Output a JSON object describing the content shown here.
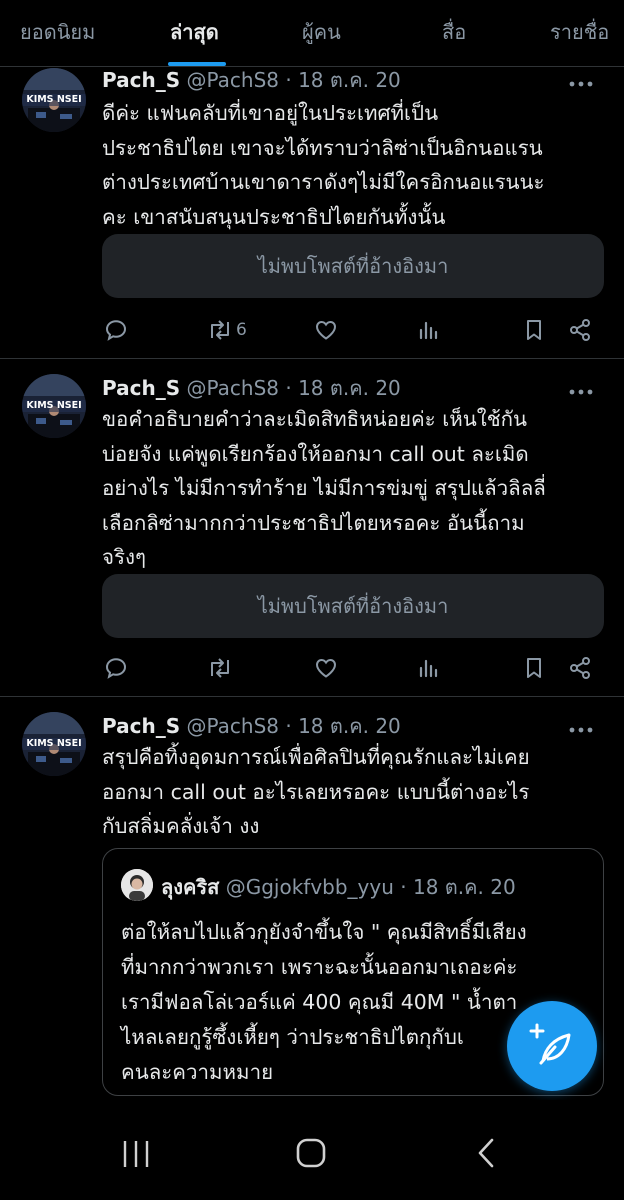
{
  "tabs": [
    {
      "label": "ยอดนิยม",
      "active": false
    },
    {
      "label": "ล่าสุด",
      "active": true
    },
    {
      "label": "ผู้คน",
      "active": false
    },
    {
      "label": "สื่อ",
      "active": false
    },
    {
      "label": "รายชื่อ",
      "active": false
    }
  ],
  "tweets": [
    {
      "name": "Pach_S",
      "handle": "@PachS8",
      "date": "· 18 ต.ค. 20",
      "text": "ดีค่ะ แฟนคลับที่เขาอยู่ในประเทศที่เป็น\nประชาธิปไตย เขาจะได้ทราบว่าลิซ่าเป็นอิกนอแรน\nต่างประเทศบ้านเขาดาราดังๆไม่มีใครอิกนอแรนนะ\nคะ เขาสนับสนุนประชาธิปไตยกันทั้งนั้น",
      "unavailable": "ไม่พบโพสต์ที่อ้างอิงมา",
      "retweets": "6",
      "avatar_text": "KIMS NSEI"
    },
    {
      "name": "Pach_S",
      "handle": "@PachS8",
      "date": "· 18 ต.ค. 20",
      "text": "ขอคำอธิบายคำว่าละเมิดสิทธิหน่อยค่ะ เห็นใช้กัน\nบ่อยจัง แค่พูดเรียกร้องให้ออกมา call out ละเมิด\nอย่างไร ไม่มีการทำร้าย ไม่มีการข่มขู่ สรุปแล้วลิลลี่\nเลือกลิซ่ามากกว่าประชาธิปไตยหรอคะ อันนี้ถาม\nจริงๆ",
      "unavailable": "ไม่พบโพสต์ที่อ้างอิงมา",
      "retweets": "",
      "avatar_text": "KIMS NSEI"
    },
    {
      "name": "Pach_S",
      "handle": "@PachS8",
      "date": "· 18 ต.ค. 20",
      "text": "สรุปคือทิ้งอุดมการณ์เพื่อศิลปินที่คุณรักและไม่เคย\nออกมา call out อะไรเลยหรอคะ แบบนี้ต่างอะไร\nกับสลิ่มคลั่งเจ้า งง",
      "avatar_text": "KIMS NSEI",
      "quote": {
        "name": "ลุงคริส",
        "handle": "@Ggjokfvbb_yyu",
        "date": "· 18 ต.ค. 20",
        "text": "ต่อให้ลบไปแล้วกุยังจำขึ้นใจ \" คุณมีสิทธิ์มีเสียง\nที่มากกว่าพวกเรา เพราะฉะนั้นออกมาเถอะค่ะ\nเรามีฟอลโล่เวอร์แค่ 400 คุณมี 40M \" น้ำตา\nไหลเลยกูรู้ซึ้งเหี้ยๆ ว่าประชาธิปไตกุกับเ\nคนละความหมาย"
      }
    }
  ],
  "colors": {
    "background": "#000000",
    "accent": "#1d9bf0",
    "secondary_text": "#8b98a5",
    "divider": "#2f3336",
    "card": "#202327"
  },
  "icons": [
    "reply-icon",
    "retweet-icon",
    "like-icon",
    "views-icon",
    "bookmark-icon",
    "share-icon",
    "more-icon",
    "compose-icon",
    "recent-apps-icon",
    "home-icon",
    "back-icon"
  ]
}
